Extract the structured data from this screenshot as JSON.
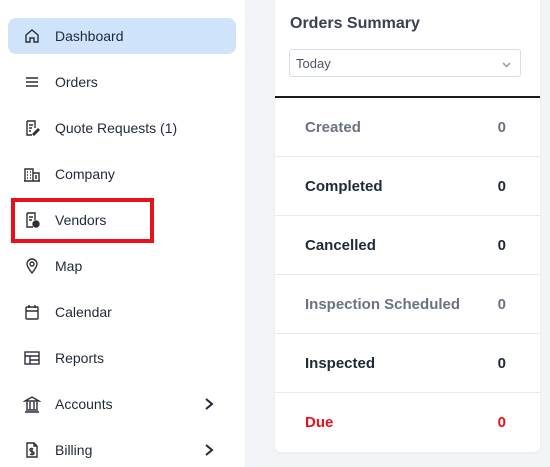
{
  "sidebar": {
    "items": [
      {
        "label": "Dashboard",
        "icon": "home-icon"
      },
      {
        "label": "Orders",
        "icon": "list-icon"
      },
      {
        "label": "Quote Requests (1)",
        "icon": "quote-document-icon"
      },
      {
        "label": "Company",
        "icon": "building-icon"
      },
      {
        "label": "Vendors",
        "icon": "vendor-document-icon"
      },
      {
        "label": "Map",
        "icon": "map-pin-icon"
      },
      {
        "label": "Calendar",
        "icon": "calendar-icon"
      },
      {
        "label": "Reports",
        "icon": "reports-icon"
      },
      {
        "label": "Accounts",
        "icon": "bank-icon"
      },
      {
        "label": "Billing",
        "icon": "billing-icon"
      }
    ],
    "active_item": "Dashboard",
    "active_color": "#cfe3fb",
    "highlight_color": "#e8101a"
  },
  "summary": {
    "title": "Orders Summary",
    "period_select": {
      "selected": "Today"
    },
    "rows": [
      {
        "label": "Created",
        "value": "0",
        "color": "#6b7280"
      },
      {
        "label": "Completed",
        "value": "0",
        "color": "#1f2937"
      },
      {
        "label": "Cancelled",
        "value": "0",
        "color": "#1f2937"
      },
      {
        "label": "Inspection Scheduled",
        "value": "0",
        "color": "#6b7280"
      },
      {
        "label": "Inspected",
        "value": "0",
        "color": "#1f2937"
      },
      {
        "label": "Due",
        "value": "0",
        "color": "#e8101a"
      }
    ]
  }
}
